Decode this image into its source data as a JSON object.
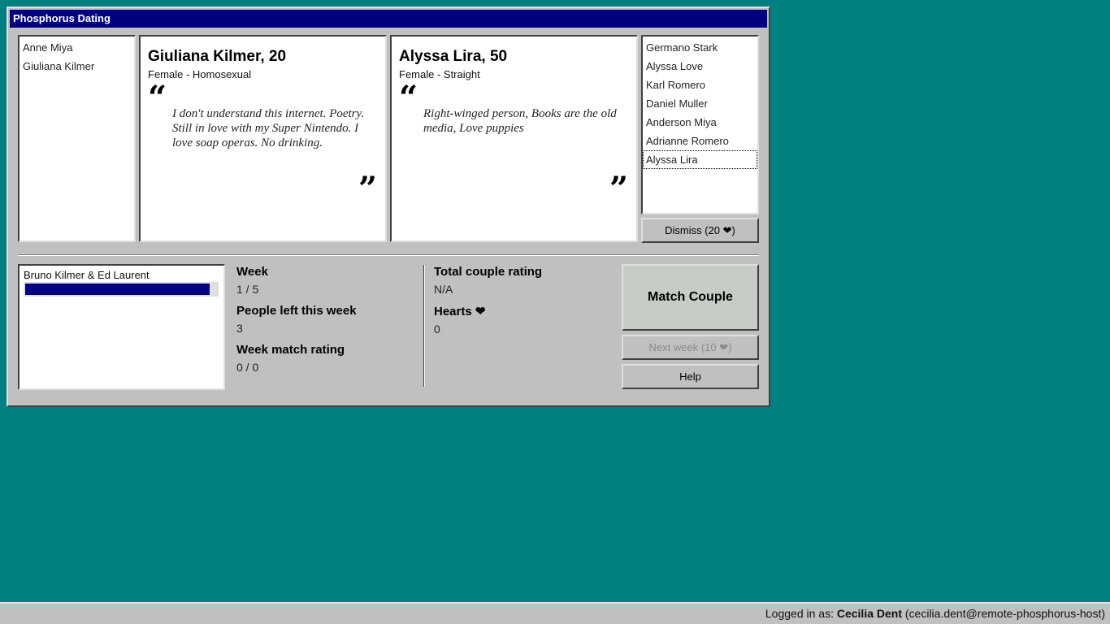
{
  "window": {
    "title": "Phosphorus Dating"
  },
  "left_list": {
    "items": [
      "Anne Miya",
      "Giuliana Kilmer"
    ]
  },
  "profile_left": {
    "name": "Giuliana Kilmer, 20",
    "subtitle": "Female - Homosexual",
    "quote_open": "“",
    "quote_close": "”",
    "quote": "I don't understand this internet. Poetry. Still in love with my Super Nintendo. I love soap operas. No drinking."
  },
  "profile_right": {
    "name": "Alyssa Lira, 50",
    "subtitle": "Female - Straight",
    "quote_open": "“",
    "quote_close": "”",
    "quote": "Right-winged person, Books are the old media, Love puppies"
  },
  "right_list": {
    "items": [
      "Germano Stark",
      "Alyssa Love",
      "Karl Romero",
      "Daniel Muller",
      "Anderson Miya",
      "Adrianne Romero",
      "Alyssa Lira"
    ],
    "selected": "Alyssa Lira"
  },
  "dismiss_button": {
    "label": "Dismiss (20",
    "suffix": ")",
    "icon": "heart-icon"
  },
  "couples_list": {
    "items": [
      {
        "name": "Bruno Kilmer & Ed Laurent",
        "progress": 0.96
      }
    ]
  },
  "stats": {
    "week_label": "Week",
    "week_value": "1 / 5",
    "people_left_label": "People left this week",
    "people_left_value": "3",
    "match_rating_label": "Week match rating",
    "match_rating_value": "0 / 0",
    "total_rating_label": "Total couple rating",
    "total_rating_value": "N/A",
    "hearts_label": "Hearts",
    "hearts_value": "0"
  },
  "buttons": {
    "match": "Match Couple",
    "next_week": "Next week (10",
    "next_week_suffix": ")",
    "help": "Help"
  },
  "status_bar": {
    "prefix": "Logged in as: ",
    "user": "Cecilia Dent",
    "email": "(cecilia.dent@remote-phosphorus-host)"
  },
  "colors": {
    "desktop": "#008080",
    "titlebar": "#000080",
    "window": "#c0c0c0"
  }
}
